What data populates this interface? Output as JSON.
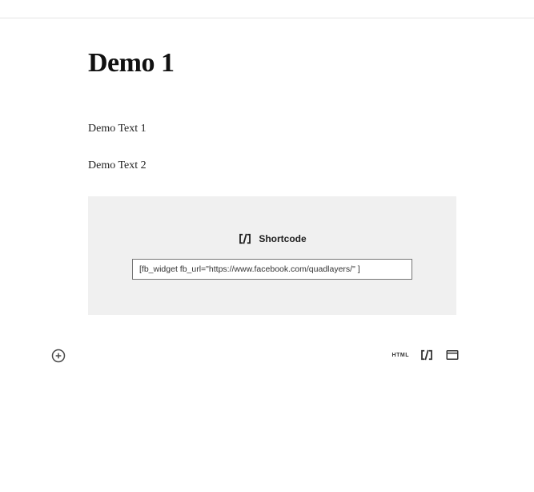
{
  "page": {
    "title": "Demo 1",
    "paragraph1": "Demo Text 1",
    "paragraph2": "Demo Text 2"
  },
  "shortcode_block": {
    "label": "Shortcode",
    "value": "[fb_widget fb_url=\"https://www.facebook.com/quadlayers/\" ]"
  },
  "inserter": {
    "html_label": "HTML"
  }
}
